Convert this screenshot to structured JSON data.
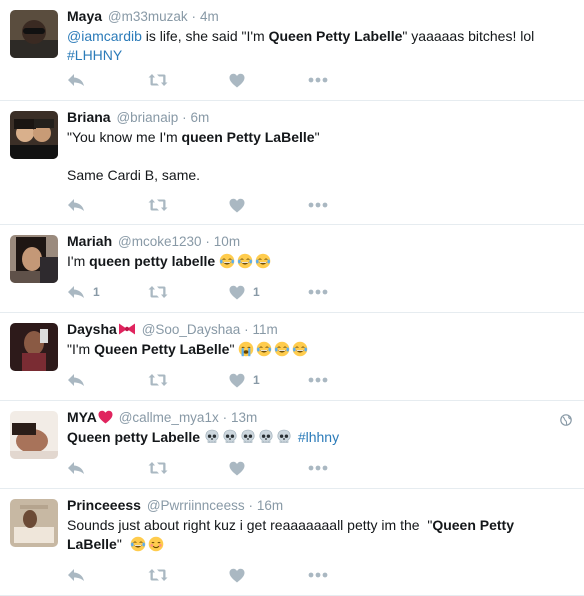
{
  "tweets": [
    {
      "fullname": "Maya",
      "handle": "@m33muzak",
      "separator": "·",
      "time": "4m",
      "parts": [
        {
          "t": "@iamcardib",
          "s": "link"
        },
        {
          "t": " is life, she said \"I'm ",
          "s": ""
        },
        {
          "t": "Queen Petty Labelle",
          "s": "bold"
        },
        {
          "t": "\" yaaaaas bitches! lol ",
          "s": ""
        },
        {
          "t": "#LHHNY",
          "s": "link"
        }
      ],
      "reply_count": "",
      "retweet_count": "",
      "like_count": ""
    },
    {
      "fullname": "Briana",
      "handle": "@brianaip",
      "separator": "·",
      "time": "6m",
      "parts": [
        {
          "t": "\"You know me I'm ",
          "s": ""
        },
        {
          "t": "queen Petty LaBelle",
          "s": "bold"
        },
        {
          "t": "\"\n\nSame Cardi B, same.",
          "s": ""
        }
      ],
      "reply_count": "",
      "retweet_count": "",
      "like_count": ""
    },
    {
      "fullname": "Mariah",
      "handle": "@mcoke1230",
      "separator": "·",
      "time": "10m",
      "parts": [
        {
          "t": "I'm ",
          "s": ""
        },
        {
          "t": "queen petty labelle",
          "s": "bold"
        },
        {
          "t": " ",
          "s": ""
        },
        {
          "t": "😂",
          "s": "emoji-laugh"
        },
        {
          "t": "😂",
          "s": "emoji-laugh"
        },
        {
          "t": "😂",
          "s": "emoji-laugh"
        }
      ],
      "reply_count": "1",
      "retweet_count": "",
      "like_count": "1"
    },
    {
      "fullname": "Daysha",
      "name_emoji": "🎀",
      "handle": "@Soo_Dayshaa",
      "separator": "·",
      "time": "11m",
      "parts": [
        {
          "t": "\"I'm ",
          "s": ""
        },
        {
          "t": "Queen Petty LaBelle",
          "s": "bold"
        },
        {
          "t": "\" ",
          "s": ""
        },
        {
          "t": "😭",
          "s": "emoji-cry"
        },
        {
          "t": "😂",
          "s": "emoji-laugh"
        },
        {
          "t": "😂",
          "s": "emoji-laugh"
        },
        {
          "t": "😂",
          "s": "emoji-laugh"
        }
      ],
      "reply_count": "",
      "retweet_count": "",
      "like_count": "1"
    },
    {
      "fullname": "MYA",
      "name_emoji": "❤",
      "handle": "@callme_mya1x",
      "separator": "·",
      "time": "13m",
      "globe": "globe-icon",
      "parts": [
        {
          "t": "Queen petty Labelle",
          "s": "bold"
        },
        {
          "t": " ",
          "s": ""
        },
        {
          "t": "💀",
          "s": "emoji-skull"
        },
        {
          "t": "💀",
          "s": "emoji-skull"
        },
        {
          "t": "💀",
          "s": "emoji-skull"
        },
        {
          "t": "💀",
          "s": "emoji-skull"
        },
        {
          "t": "💀",
          "s": "emoji-skull"
        },
        {
          "t": " ",
          "s": ""
        },
        {
          "t": "#lhhny",
          "s": "link"
        }
      ],
      "reply_count": "",
      "retweet_count": "",
      "like_count": ""
    },
    {
      "fullname": "Princeeess",
      "handle": "@Pwrriinnceess",
      "separator": "·",
      "time": "16m",
      "parts": [
        {
          "t": "Sounds just about right kuz i get reaaaaaaall petty im the  \"",
          "s": ""
        },
        {
          "t": "Queen Petty LaBelle",
          "s": "bold"
        },
        {
          "t": "\"  ",
          "s": ""
        },
        {
          "t": "😂",
          "s": "emoji-laugh"
        },
        {
          "t": "😊",
          "s": "emoji-blush"
        }
      ],
      "reply_count": "",
      "retweet_count": "",
      "like_count": ""
    }
  ],
  "colors": {
    "link": "#2b7bb9",
    "muted": "#8899a6",
    "icon": "#aab8c2",
    "divider": "#e6ecf0",
    "heart_red": "#e0245e",
    "bow_red": "#e0245e"
  },
  "icons": {
    "reply": "reply-icon",
    "retweet": "retweet-icon",
    "like": "heart-icon",
    "more": "more-icon"
  }
}
